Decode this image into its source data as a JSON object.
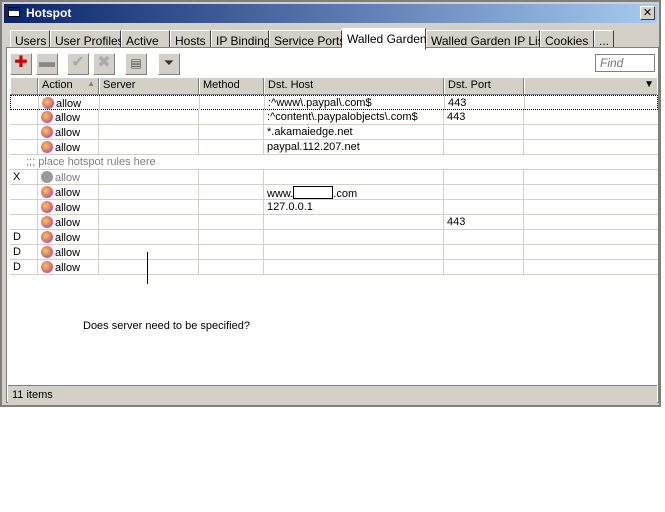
{
  "window": {
    "title": "Hotspot",
    "close_label": "✕"
  },
  "tabs": [
    "Users",
    "User Profiles",
    "Active",
    "Hosts",
    "IP Bindings",
    "Service Ports",
    "Walled Garden",
    "Walled Garden IP List",
    "Cookies",
    "..."
  ],
  "active_tab": "Walled Garden",
  "toolbar": {
    "find_placeholder": "Find"
  },
  "columns": [
    "Action",
    "Server",
    "Method",
    "Dst. Host",
    "Dst. Port"
  ],
  "sort_indicator": "▲",
  "column_menu": "▼",
  "rows": [
    {
      "flag": "",
      "action": "allow",
      "server": "",
      "method": "",
      "dst_host": ":^www\\.paypal\\.com$",
      "dst_port": "443",
      "selected": true
    },
    {
      "flag": "",
      "action": "allow",
      "server": "",
      "method": "",
      "dst_host": ":^content\\.paypalobjects\\.com$",
      "dst_port": "443"
    },
    {
      "flag": "",
      "action": "allow",
      "server": "",
      "method": "",
      "dst_host": "*.akamaiedge.net",
      "dst_port": ""
    },
    {
      "flag": "",
      "action": "allow",
      "server": "",
      "method": "",
      "dst_host": "paypal.112.207.net",
      "dst_port": ""
    },
    {
      "comment": ";;; place hotspot rules here"
    },
    {
      "flag": "X",
      "action": "allow",
      "server": "",
      "method": "",
      "dst_host": "",
      "dst_port": "",
      "disabled": true
    },
    {
      "flag": "",
      "action": "allow",
      "server": "",
      "method": "",
      "dst_host_pre": "www.",
      "dst_host_post": ".com",
      "redacted": true,
      "dst_port": ""
    },
    {
      "flag": "",
      "action": "allow",
      "server": "",
      "method": "",
      "dst_host": "127.0.0.1",
      "dst_port": ""
    },
    {
      "flag": "",
      "action": "allow",
      "server": "",
      "method": "",
      "dst_host": "",
      "dst_port": "443"
    },
    {
      "flag": "D",
      "action": "allow",
      "server": "",
      "method": "",
      "dst_host": "",
      "dst_port": ""
    },
    {
      "flag": "D",
      "action": "allow",
      "server": "",
      "method": "",
      "dst_host": "",
      "dst_port": ""
    },
    {
      "flag": "D",
      "action": "allow",
      "server": "",
      "method": "",
      "dst_host": "",
      "dst_port": ""
    }
  ],
  "annotation": "Does server need to be specified?",
  "status": {
    "items": "11 items"
  },
  "colors": {
    "title_start": "#0a246a",
    "title_end": "#a6caf0",
    "chrome": "#d4d0c8",
    "add_icon": "#cc0000"
  }
}
